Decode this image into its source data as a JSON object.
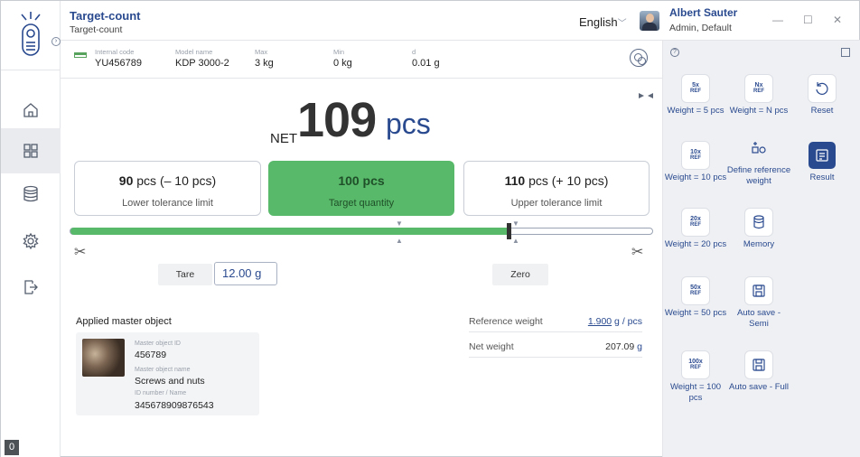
{
  "header": {
    "title": "Target-count",
    "subtitle": "Target-count",
    "language": "English",
    "user_name": "Albert Sauter",
    "user_role": "Admin, Default",
    "minimize": "—",
    "maximize": "☐",
    "close": "✕"
  },
  "info": {
    "internal_code_label": "Internal code",
    "internal_code": "YU456789",
    "model_label": "Model name",
    "model": "KDP 3000-2",
    "max_label": "Max",
    "max": "3 kg",
    "min_label": "Min",
    "min": "0 kg",
    "d_label": "d",
    "d": "0.01 g"
  },
  "display": {
    "net_label": "NET",
    "value": "109",
    "unit": "pcs"
  },
  "tolerance": {
    "lower_value": "90",
    "lower_rest": " pcs (– 10 pcs)",
    "lower_label": "Lower tolerance limit",
    "target_value": "100 pcs",
    "target_label": "Target quantity",
    "upper_value": "110",
    "upper_rest": " pcs (+ 10 pcs)",
    "upper_label": "Upper tolerance limit",
    "fill_fraction": 0.755
  },
  "controls": {
    "tare_label": "Tare",
    "tare_value": "12.00",
    "tare_unit": "g",
    "zero_label": "Zero"
  },
  "master": {
    "title": "Applied master object",
    "id_label": "Master object ID",
    "id": "456789",
    "name_label": "Master object name",
    "name": "Screws and nuts",
    "idnum_label": "ID number / Name",
    "idnum": "345678909876543"
  },
  "reference": {
    "ref_label": "Reference weight",
    "ref_value": "1.900",
    "ref_unit": " g / pcs",
    "net_label": "Net weight",
    "net_value": "207.09",
    "net_unit": " g"
  },
  "panel": {
    "help": "?",
    "t1_badge": "5x",
    "t1_ref": "REF",
    "t1_label": "Weight = 5 pcs",
    "t2_badge": "Nx",
    "t2_ref": "REF",
    "t2_label": "Weight = N pcs",
    "t3_label": "Reset",
    "t4_badge": "10x",
    "t4_ref": "REF",
    "t4_label": "Weight = 10 pcs",
    "t5_label": "Define reference weight",
    "t6_label": "Result",
    "t7_badge": "20x",
    "t7_ref": "REF",
    "t7_label": "Weight = 20 pcs",
    "t8_label": "Memory",
    "t9_badge": "50x",
    "t9_ref": "REF",
    "t9_label": "Weight = 50 pcs",
    "t10_label": "Auto save - Semi",
    "t11_badge": "100x",
    "t11_ref": "REF",
    "t11_label": "Weight = 100 pcs",
    "t12_label": "Auto save - Full"
  },
  "badge": "0",
  "colors": {
    "accent": "#2a4a8f",
    "target_green": "#58b96a"
  }
}
